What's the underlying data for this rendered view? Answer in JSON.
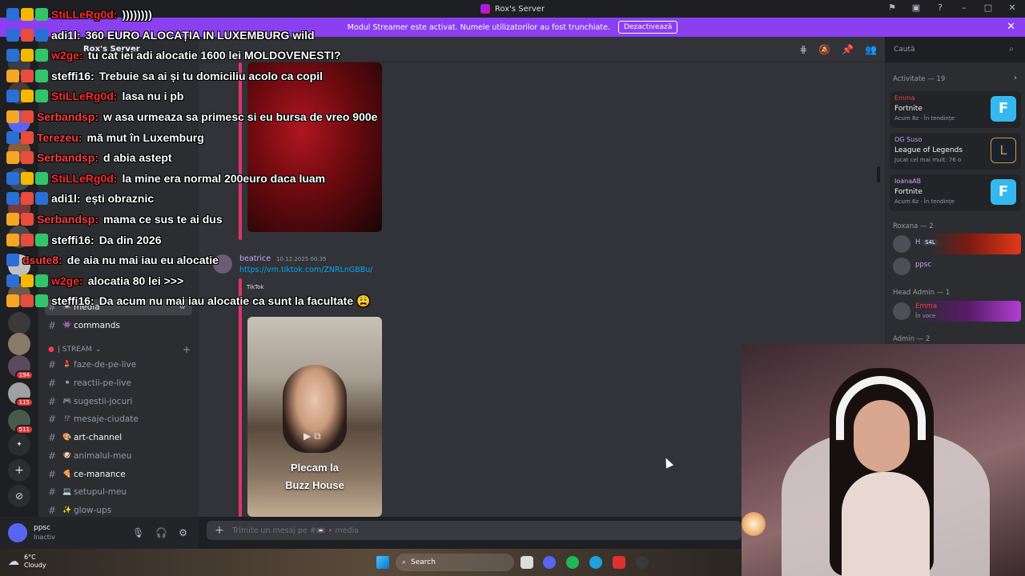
{
  "window": {
    "title": "Rox's Server"
  },
  "banner": {
    "text": "Modul Streamer este activat. Numele utilizatorilor au fost trunchiate.",
    "button": "Dezactivează",
    "close": "✕"
  },
  "server": {
    "name": "Rox's Server"
  },
  "search": {
    "placeholder": "Caută"
  },
  "sidebar": {
    "categories": {
      "stream": "| STREAM"
    },
    "channels": [
      {
        "name": "media",
        "emoji": "📼",
        "active": true
      },
      {
        "name": "commands",
        "emoji": "👾",
        "bold": true
      },
      {
        "name": "faze-de-pe-live",
        "emoji": "💄"
      },
      {
        "name": "reactii-pe-live",
        "emoji": "⚫"
      },
      {
        "name": "sugestii-jocuri",
        "emoji": "🎮"
      },
      {
        "name": "mesaje-ciudate",
        "emoji": "⁉"
      },
      {
        "name": "art-channel",
        "emoji": "🎨",
        "bold": true
      },
      {
        "name": "animalul-meu",
        "emoji": "🐶"
      },
      {
        "name": "ce-manance",
        "emoji": "🍕",
        "bold": true
      },
      {
        "name": "setupul-meu",
        "emoji": "💻"
      },
      {
        "name": "glow-ups",
        "emoji": "✨"
      }
    ]
  },
  "rail": {
    "badges": [
      "194",
      "115",
      "511"
    ]
  },
  "user": {
    "name": "ppsc",
    "status": "Inactiv"
  },
  "chat": {
    "message": {
      "author": "beatrice",
      "time": "10.12.2025 00:35",
      "link": "https://vm.tiktok.com/ZNRLnGBBu/",
      "provider": "TikTok",
      "caption_line1": "Plecam la",
      "caption_line2": "Buzz House"
    },
    "composer_placeholder": "Trimite un mesaj pe #📼 • media"
  },
  "members": {
    "activity_header": "Activitate — 19",
    "activities": [
      {
        "user": "Emma",
        "game": "Fortnite",
        "sub": "Acum 8z · În tendințe",
        "color": "#f23f43",
        "icon_color": "#35b8f0"
      },
      {
        "user": "OG Suso",
        "game": "League of Legends",
        "sub": "Jucat cel mai mult: 76 o",
        "color": "#c9a3ff",
        "icon_color": "#c89b3c"
      },
      {
        "user": "IoanaAB",
        "game": "Fortnite",
        "sub": "Acum 6z · În tendințe",
        "color": "#c9a3ff",
        "icon_color": "#35b8f0"
      }
    ],
    "roles": [
      {
        "title": "Roxana — 2"
      },
      {
        "title": "Head Admin — 1"
      },
      {
        "title": "Admin — 2"
      }
    ],
    "rows": [
      {
        "name": "H",
        "tag": "S4L",
        "status": "",
        "color": "#c9a3ff"
      },
      {
        "name": "ppsc",
        "tag": "",
        "status": "",
        "color": "#c9a3ff"
      },
      {
        "name": "Emma",
        "tag": "",
        "status": "În voce",
        "color": "#f23f43"
      }
    ]
  },
  "overlay": {
    "lines": [
      {
        "user": "StiLLeRg0d:",
        "text": "))))))))",
        "ucolor": "#ff2b2b",
        "badges": [
          "#2a6fd6",
          "#f5b800",
          "#33c46b"
        ]
      },
      {
        "user": "adi1l:",
        "text": "360 EURO ALOCAȚIA IN LUXEMBURG wild",
        "ucolor": "#ffffff",
        "badges": [
          "#2a6fd6",
          "#e84c3d",
          "#2a6fd6"
        ]
      },
      {
        "user": "w2ge:",
        "text": "tu cat iei adi alocatie 1600 lei MOLDOVENESTI?",
        "ucolor": "#ff2b2b",
        "badges": [
          "#2a6fd6",
          "#f5b800",
          "#33c46b"
        ]
      },
      {
        "user": "steffi16:",
        "text": "Trebuie sa ai și tu domiciliu acolo ca copil",
        "ucolor": "#ffffff",
        "badges": [
          "#f5a623",
          "#e84c3d",
          "#33c46b"
        ]
      },
      {
        "user": "StiLLeRg0d:",
        "text": "lasa nu i pb",
        "ucolor": "#ff2b2b",
        "badges": [
          "#2a6fd6",
          "#f5b800",
          "#33c46b"
        ]
      },
      {
        "user": "Serbandsp:",
        "text": "w asa urmeaza sa primesc si eu bursa de vreo 900e",
        "ucolor": "#ff3e3e",
        "badges": [
          "#f5a623",
          "#e84c3d"
        ]
      },
      {
        "user": "Terezeu:",
        "text": "mă mut în Luxemburg",
        "ucolor": "#ff3e3e",
        "badges": [
          "#2a6fd6",
          "#e84c3d"
        ]
      },
      {
        "user": "Serbandsp:",
        "text": "d abia astept",
        "ucolor": "#ff3e3e",
        "badges": [
          "#f5a623",
          "#e84c3d"
        ]
      },
      {
        "user": "StiLLeRg0d:",
        "text": "la mine era normal 200euro daca luam",
        "ucolor": "#ff2b2b",
        "badges": [
          "#2a6fd6",
          "#f5b800",
          "#33c46b"
        ]
      },
      {
        "user": "adi1l:",
        "text": "ești obraznic",
        "ucolor": "#ffffff",
        "badges": [
          "#2a6fd6",
          "#e84c3d",
          "#2a6fd6"
        ]
      },
      {
        "user": "Serbandsp:",
        "text": "mama ce sus te ai dus",
        "ucolor": "#ff3e3e",
        "badges": [
          "#f5a623",
          "#e84c3d"
        ]
      },
      {
        "user": "steffi16:",
        "text": "Da din 2026",
        "ucolor": "#ffffff",
        "badges": [
          "#f5a623",
          "#e84c3d",
          "#33c46b"
        ]
      },
      {
        "user": "dsute8:",
        "text": "de aia nu mai iau eu alocatie",
        "ucolor": "#ff3e3e",
        "badges": [
          "#2a6fd6"
        ]
      },
      {
        "user": "w2ge:",
        "text": "alocatia 80 lei >>>",
        "ucolor": "#ff2b2b",
        "badges": [
          "#2a6fd6",
          "#f5b800",
          "#33c46b"
        ]
      },
      {
        "user": "steffi16:",
        "text": "Da acum nu mai iau alocatie ca sunt la facultate 😩",
        "ucolor": "#ffffff",
        "badges": [
          "#f5a623",
          "#e84c3d",
          "#33c46b"
        ]
      }
    ]
  },
  "taskbar": {
    "temp": "6°C",
    "weather": "Cloudy",
    "search": "Search"
  }
}
